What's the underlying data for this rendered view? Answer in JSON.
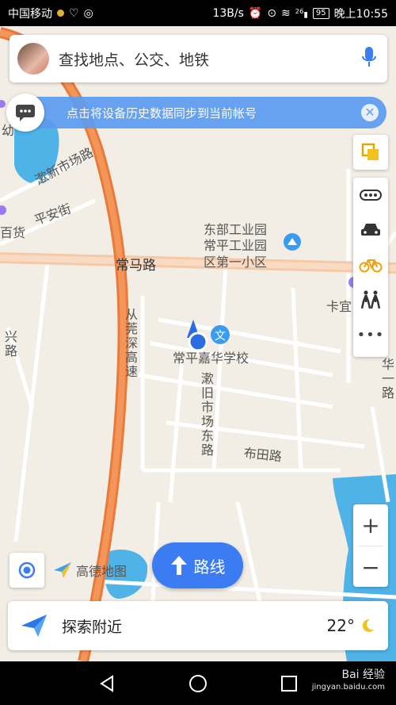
{
  "status_bar": {
    "carrier": "中国移动",
    "speed": "13B/s",
    "signal_label": "26",
    "battery": "95",
    "time": "晚上10:55"
  },
  "search": {
    "placeholder": "查找地点、公交、地铁"
  },
  "notice": {
    "text": "点击将设备历史数据同步到当前帐号"
  },
  "map": {
    "labels": {
      "road_changma": "常马路",
      "road_changma_school": "幼",
      "road_shichang": "漱新市场路",
      "road_pingan": "平安街",
      "label_baihuo": "百货",
      "label_gongye1": "东部工业园",
      "label_gongye2": "常平工业园",
      "label_xiaoqu": "区第一小区",
      "highway": "从莞深高速",
      "school": "常平嘉华学校",
      "road_dong": "漱旧市场东路",
      "road_butian": "布田路",
      "label_kayi": "卡宜",
      "label_xinglu": "兴路",
      "label_yilu": "华一路"
    },
    "colors": {
      "highway": "#f08a4b",
      "water": "#4fb3e8",
      "road": "#ffffff",
      "background": "#f3eee5"
    }
  },
  "brand": {
    "name": "高德地图"
  },
  "route_button": {
    "label": "路线"
  },
  "bottom_card": {
    "label": "探索附近",
    "temperature": "22°"
  },
  "watermark": {
    "line1": "Bai 经验",
    "line2": "jingyan.baidu.com"
  },
  "icons": {
    "search_bar": [
      "avatar",
      "microphone-icon"
    ],
    "right_panel": [
      "layers-icon",
      "traffic-icon",
      "car-icon",
      "bike-icon",
      "walk-icon",
      "more-icon"
    ],
    "zoom": [
      "zoom-in-icon",
      "zoom-out-icon"
    ],
    "bottom": [
      "locate-icon",
      "navigate-arrow-icon",
      "moon-icon"
    ]
  }
}
